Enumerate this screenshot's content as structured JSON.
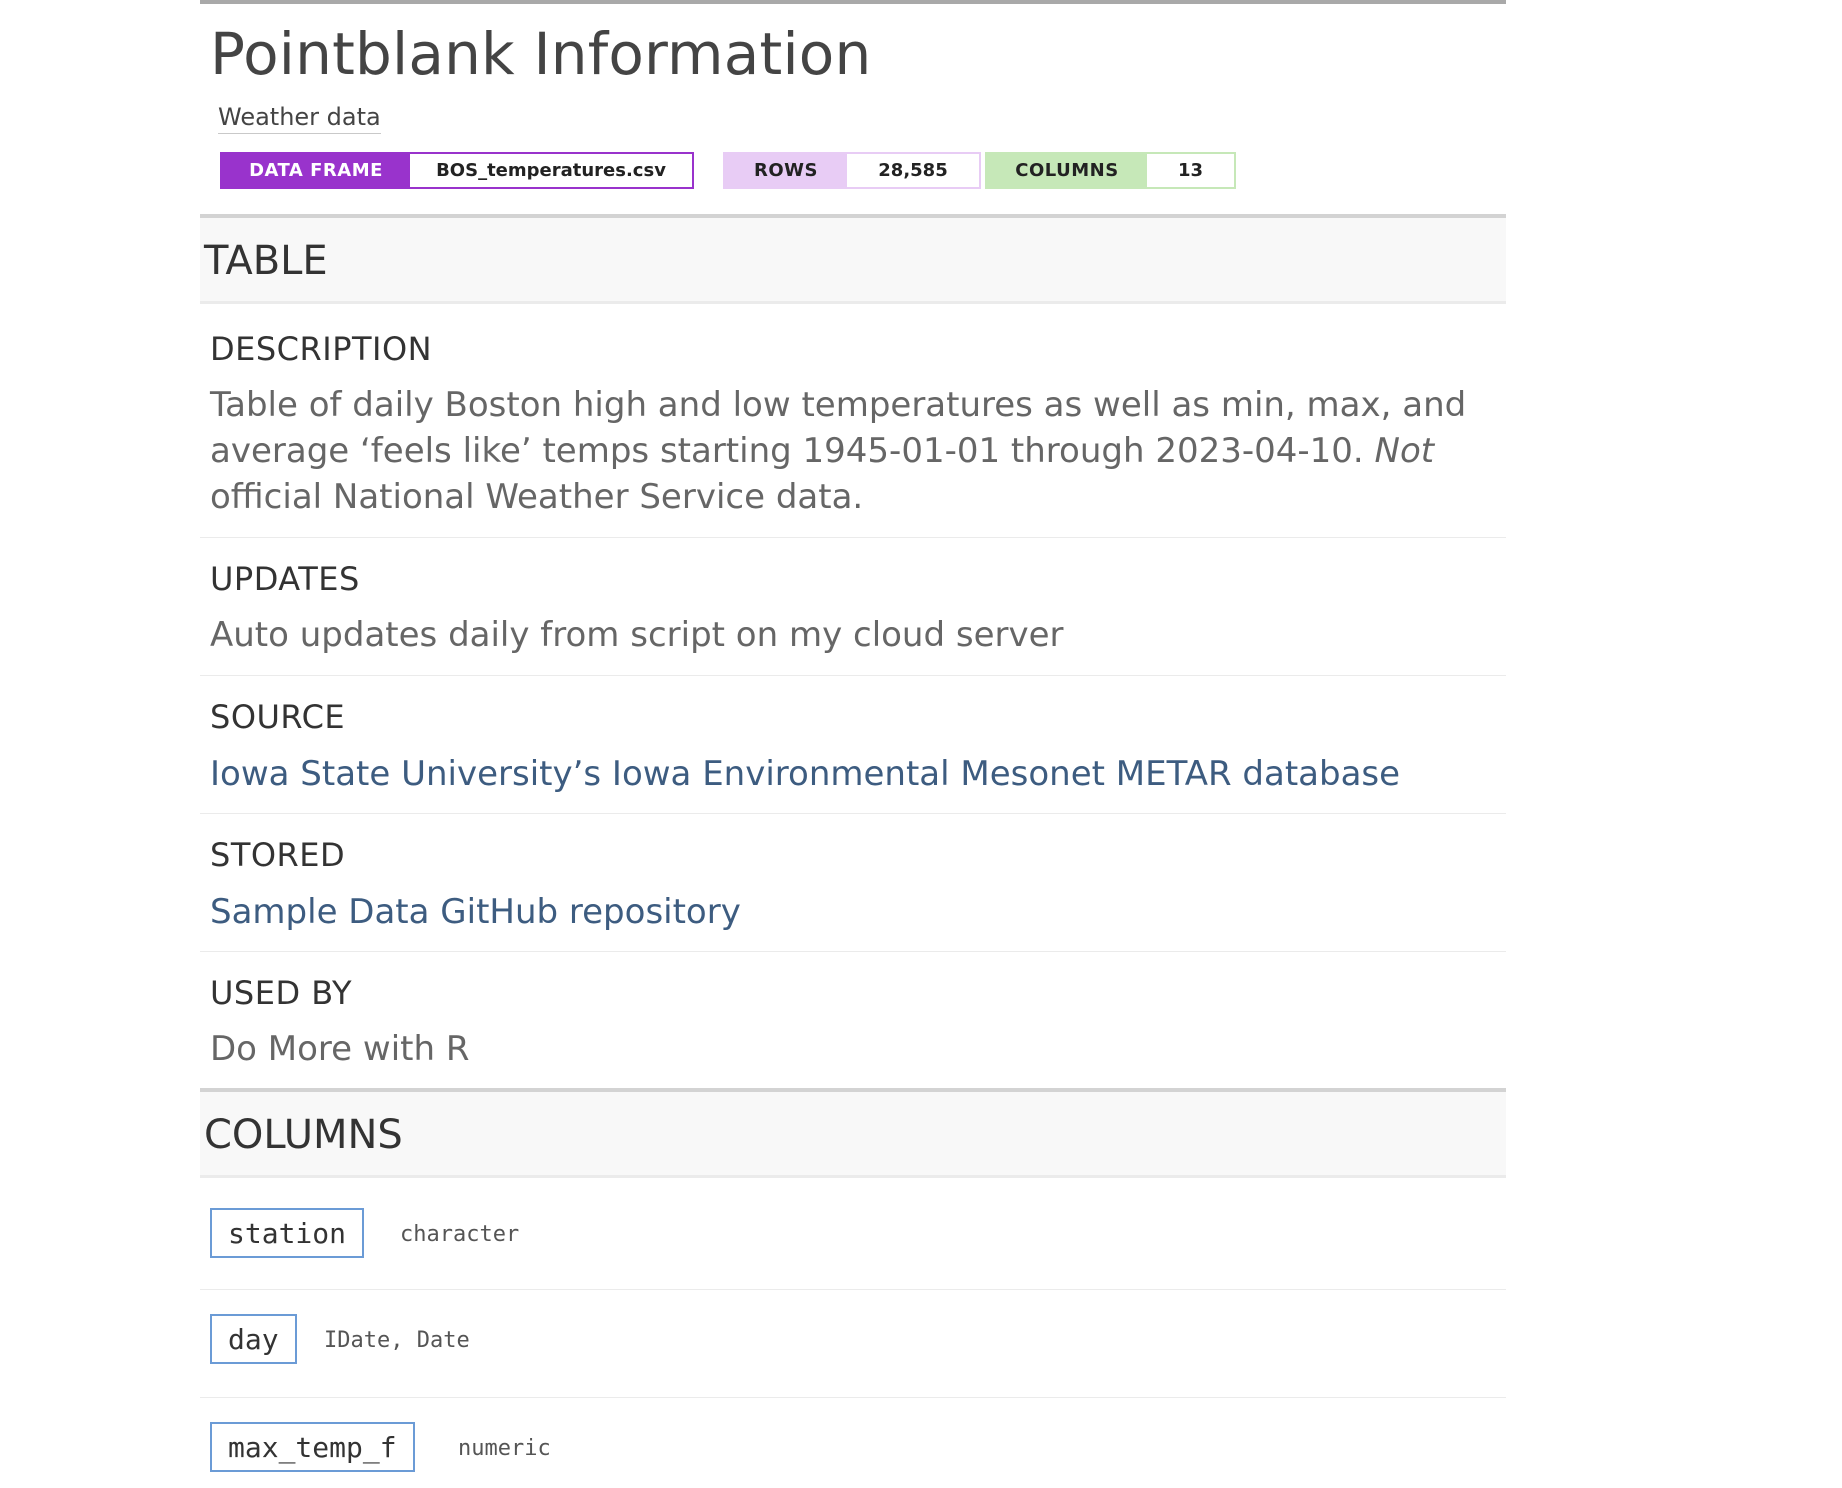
{
  "header": {
    "title": "Pointblank Information",
    "subtitle": "Weather data"
  },
  "badges": {
    "data_frame_label": "DATA FRAME",
    "data_frame_value": "BOS_temperatures.csv",
    "rows_label": "ROWS",
    "rows_value": "28,585",
    "columns_label": "COLUMNS",
    "columns_value": "13",
    "colors": {
      "data_frame": "#9933cc",
      "rows": "#e8ccf5",
      "columns": "#c6e8b8"
    }
  },
  "table_section": {
    "label": "TABLE",
    "description": {
      "heading": "DESCRIPTION",
      "text_before": "Table of daily Boston high and low temperatures as well as min, max, and average ‘feels like’ temps starting 1945-01-01 through 2023-04-10. ",
      "text_emphasis": "Not",
      "text_after": " official National Weather Service data."
    },
    "updates": {
      "heading": "UPDATES",
      "text": "Auto updates daily from script on my cloud server"
    },
    "source": {
      "heading": "SOURCE",
      "link_text": "Iowa State University’s Iowa Environmental Mesonet METAR database"
    },
    "stored": {
      "heading": "STORED",
      "link_text": "Sample Data GitHub repository"
    },
    "used_by": {
      "heading": "USED BY",
      "text": "Do More with R"
    }
  },
  "columns_section": {
    "label": "COLUMNS",
    "columns": [
      {
        "name": "station",
        "type": "character"
      },
      {
        "name": "day",
        "type": "IDate, Date"
      },
      {
        "name": "max_temp_f",
        "type": "numeric"
      }
    ]
  },
  "colors": {
    "link": "#3d5c80",
    "column_border": "#6b9bd6"
  }
}
